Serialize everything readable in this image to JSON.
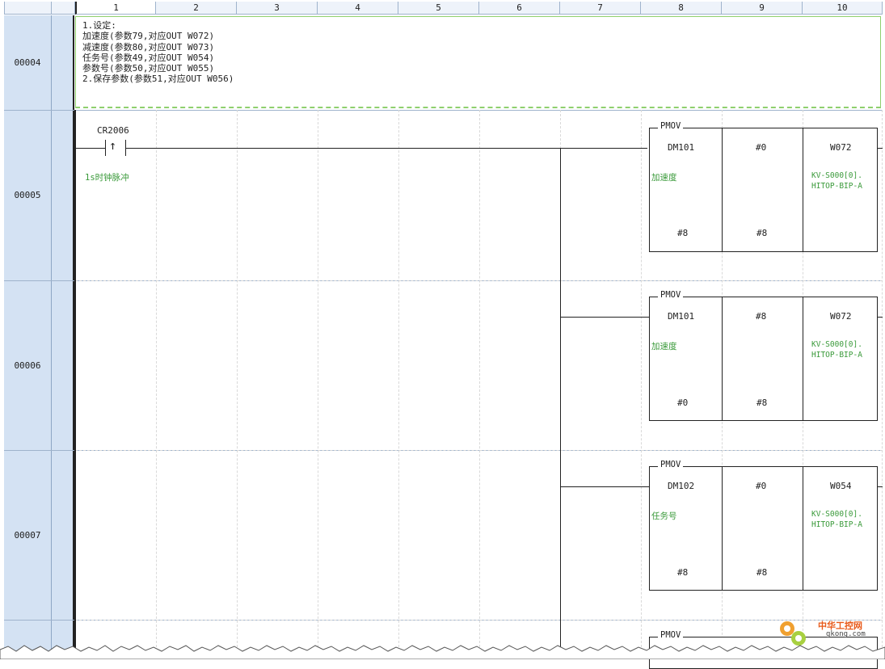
{
  "columns": [
    "1",
    "2",
    "3",
    "4",
    "5",
    "6",
    "7",
    "8",
    "9",
    "10"
  ],
  "rows": {
    "r4": "00004",
    "r5": "00005",
    "r6": "00006",
    "r7": "00007"
  },
  "comment": {
    "line1": "1.设定:",
    "line2": "加速度(参数79,对应OUT W072)",
    "line3": "减速度(参数80,对应OUT W073)",
    "line4": "任务号(参数49,对应OUT W054)",
    "line5": "参数号(参数50,对应OUT W055)",
    "line6": "2.保存参数(参数51,对应OUT W056)"
  },
  "contact": {
    "name": "CR2006",
    "symbol": "↑",
    "label": "1s时钟脉冲"
  },
  "blocks": [
    {
      "func": "PMOV",
      "src": "DM101",
      "mid": "#0",
      "dst": "W072",
      "src_label": "加速度",
      "dst_label1": "KV-S000[0].",
      "dst_label2": "HITOP-BIP-A",
      "n1": "#8",
      "n2": "#8"
    },
    {
      "func": "PMOV",
      "src": "DM101",
      "mid": "#8",
      "dst": "W072",
      "src_label": "加速度",
      "dst_label1": "KV-S000[0].",
      "dst_label2": "HITOP-BIP-A",
      "n1": "#0",
      "n2": "#8"
    },
    {
      "func": "PMOV",
      "src": "DM102",
      "mid": "#0",
      "dst": "W054",
      "src_label": "任务号",
      "dst_label1": "KV-S000[0].",
      "dst_label2": "HITOP-BIP-A",
      "n1": "#8",
      "n2": "#8"
    },
    {
      "func": "PMOV"
    }
  ],
  "watermark": {
    "cn": "中华工控网",
    "url": "gkong.com"
  }
}
